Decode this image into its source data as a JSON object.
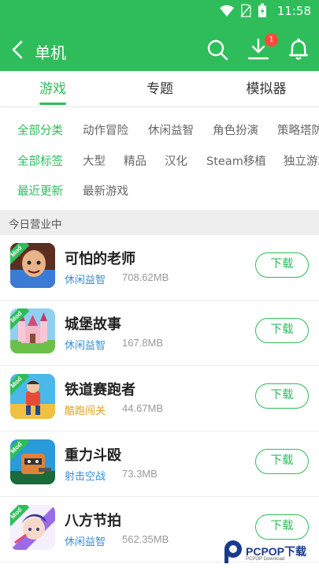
{
  "status": {
    "time": "11:58"
  },
  "header": {
    "title": "单机",
    "download_badge": "1"
  },
  "tabs": [
    {
      "label": "游戏",
      "active": true
    },
    {
      "label": "专题",
      "active": false
    },
    {
      "label": "模拟器",
      "active": false
    }
  ],
  "filters": {
    "categories": [
      "全部分类",
      "动作冒险",
      "休闲益智",
      "角色扮演",
      "策略塔防"
    ],
    "tags": [
      "全部标签",
      "大型",
      "精品",
      "汉化",
      "Steam移植",
      "独立游戏"
    ],
    "sort": [
      "最近更新",
      "最新游戏"
    ]
  },
  "section": {
    "title": "今日营业中"
  },
  "games": [
    {
      "name": "可怕的老师",
      "category": "休闲益智",
      "category_color": "#3a8fd6",
      "size": "708.62MB",
      "badge": "Mod",
      "button": "下载",
      "icon": "scary-teacher-icon"
    },
    {
      "name": "城堡故事",
      "category": "休闲益智",
      "category_color": "#3a8fd6",
      "size": "167.8MB",
      "badge": "Mod",
      "button": "下载",
      "icon": "castle-story-icon"
    },
    {
      "name": "铁道赛跑者",
      "category": "酷跑闯关",
      "category_color": "#e0a020",
      "size": "44.67MB",
      "badge": "Mod",
      "button": "下载",
      "icon": "rail-runner-icon"
    },
    {
      "name": "重力斗殴",
      "category": "射击空战",
      "category_color": "#3a8fd6",
      "size": "73.3MB",
      "badge": "Mod",
      "button": "下载",
      "icon": "gravity-brawl-icon"
    },
    {
      "name": "八方节拍",
      "category": "休闲益智",
      "category_color": "#3a8fd6",
      "size": "562.35MB",
      "badge": "Mod",
      "button": "下载",
      "icon": "eight-beats-icon"
    }
  ],
  "watermark": {
    "text": "PCPOP下载",
    "sub": "PCPOP Download"
  },
  "colors": {
    "accent": "#2ebd5a",
    "badge": "#ff4b3a"
  }
}
